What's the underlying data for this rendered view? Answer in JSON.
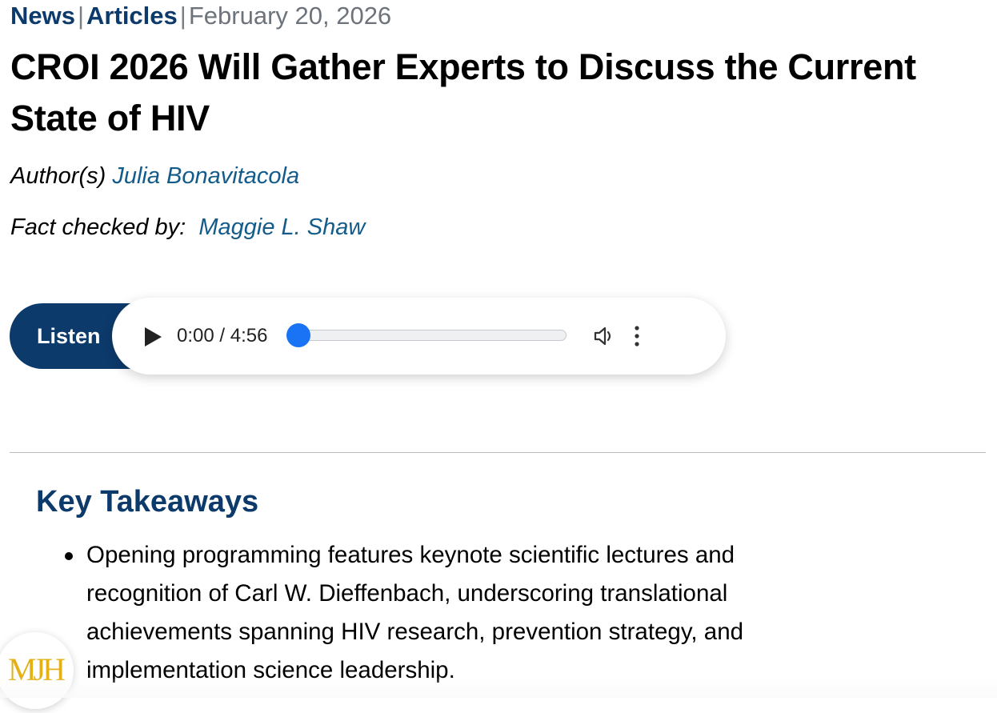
{
  "breadcrumb": {
    "category1": "News",
    "separator": "|",
    "category2": "Articles",
    "date": "February 20, 2026"
  },
  "article": {
    "title": "CROI 2026 Will Gather Experts to Discuss the Current State of HIV",
    "author_label": "Author(s)",
    "author_name": "Julia Bonavitacola",
    "factcheck_label": "Fact checked by:",
    "factcheck_name": "Maggie L. Shaw"
  },
  "audio": {
    "listen_label": "Listen",
    "time_display": "0:00 / 4:56",
    "current_seconds": 0,
    "duration_seconds": 296
  },
  "key_takeaways": {
    "heading": "Key Takeaways",
    "items": [
      "Opening programming features keynote scientific lectures and recognition of Carl W. Dieffenbach, underscoring translational achievements spanning HIV research, prevention strategy, and implementation science leadership."
    ]
  },
  "colors": {
    "brand_navy": "#0c3a6b",
    "link_blue": "#135b8a",
    "audio_accent": "#1a73f5",
    "logo_gold": "#e3b016"
  },
  "icons": {
    "play": "play-icon",
    "volume": "volume-icon",
    "more": "more-vert-icon"
  },
  "logo": {
    "text": "MJH"
  }
}
